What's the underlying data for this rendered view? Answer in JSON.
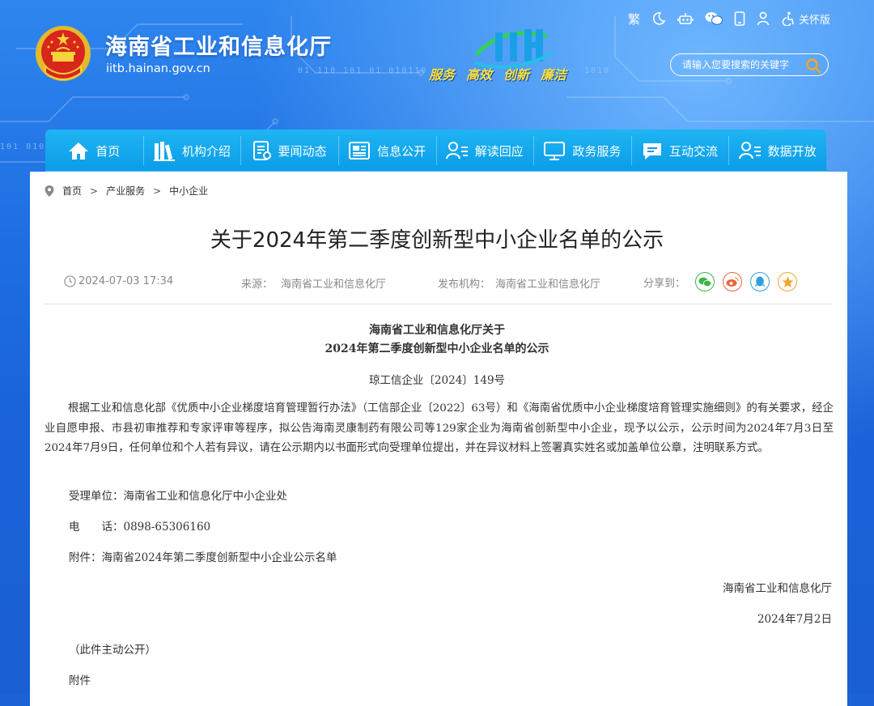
{
  "header": {
    "site_title": "海南省工业和信息化厅",
    "site_url": "iitb.hainan.gov.cn",
    "slogan": [
      "服务",
      "高效",
      "创新",
      "廉洁"
    ],
    "tools": {
      "traditional": "繁",
      "care_mode": "关怀版"
    },
    "search_placeholder": "请输入您要搜索的关键字"
  },
  "nav": [
    {
      "label": "首页",
      "icon": "home-icon"
    },
    {
      "label": "机构介绍",
      "icon": "books-icon"
    },
    {
      "label": "要闻动态",
      "icon": "news-icon"
    },
    {
      "label": "信息公开",
      "icon": "newspaper-icon"
    },
    {
      "label": "解读回应",
      "icon": "user-list-icon"
    },
    {
      "label": "政务服务",
      "icon": "monitor-icon"
    },
    {
      "label": "互动交流",
      "icon": "chat-icon"
    },
    {
      "label": "数据开放",
      "icon": "user-list-icon"
    }
  ],
  "breadcrumb": [
    "首页",
    "产业服务",
    "中小企业"
  ],
  "article": {
    "title": "关于2024年第二季度创新型中小企业名单的公示",
    "datetime": "2024-07-03 17:34",
    "source_label": "来源：",
    "source": "海南省工业和信息化厅",
    "publisher_label": "发布机构：",
    "publisher": "海南省工业和信息化厅",
    "share_label": "分享到：",
    "heading_line1": "海南省工业和信息化厅关于",
    "heading_line2": "2024年第二季度创新型中小企业名单的公示",
    "doc_number": "琼工信企业〔2024〕149号",
    "body": "根据工业和信息化部《优质中小企业梯度培育管理暂行办法》（工信部企业〔2022〕63号）和《海南省优质中小企业梯度培育管理实施细则》的有关要求，经企业自愿申报、市县初审推荐和专家评审等程序，拟公告海南灵康制药有限公司等129家企业为海南省创新型中小企业，现予以公示，公示时间为2024年7月3日至2024年7月9日，任何单位和个人若有异议，请在公示期内以书面形式向受理单位提出，并在异议材料上签署真实姓名或加盖单位公章，注明联系方式。",
    "receiver": "受理单位：海南省工业和信息化厅中小企业处",
    "phone_label": "电　　话：",
    "phone": "0898-65306160",
    "attachment_line": "附件：海南省2024年第二季度创新型中小企业公示名单",
    "signature": "海南省工业和信息化厅",
    "sign_date": "2024年7月2日",
    "public_note": "（此件主动公开）",
    "attachment_title": "附件"
  },
  "colors": {
    "header_blue": "#1e6ee2",
    "nav_blue": "#0a9ce8",
    "slogan_yellow": "#ffe23a",
    "wechat_green": "#3bb54a",
    "weibo_red": "#e8643c",
    "qq_blue": "#2d9fe0",
    "fav_orange": "#f2a62d"
  }
}
